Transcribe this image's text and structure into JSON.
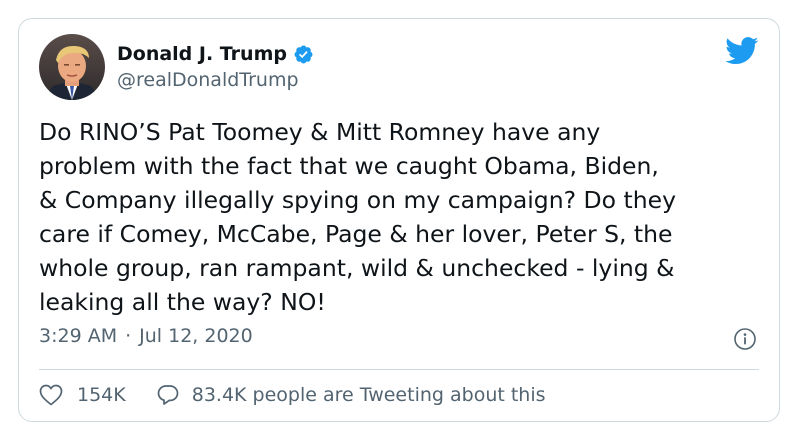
{
  "tweet": {
    "author_name": "Donald J. Trump",
    "handle": "@realDonaldTrump",
    "verified": true,
    "text": "Do RINO’S Pat Toomey & Mitt Romney have any\nproblem with the fact that we caught Obama, Biden,\n& Company illegally spying on my campaign? Do they\ncare if Comey, McCabe, Page & her lover, Peter S, the\nwhole group, ran rampant, wild & unchecked - lying &\nleaking all the way? NO!",
    "time": "3:29 AM",
    "separator": "·",
    "date": "Jul 12, 2020"
  },
  "actions": {
    "like_count": "154K",
    "conversation_text": "83.4K people are Tweeting about this"
  },
  "icons": {
    "brand": "twitter-bird-icon",
    "verified": "verified-badge-icon",
    "info": "info-icon",
    "like": "heart-icon",
    "reply": "comment-bubble-icon"
  },
  "colors": {
    "brand_blue": "#1d9bf0",
    "text_primary": "#0f1419",
    "text_secondary": "#536471",
    "border": "#cfd9de"
  }
}
